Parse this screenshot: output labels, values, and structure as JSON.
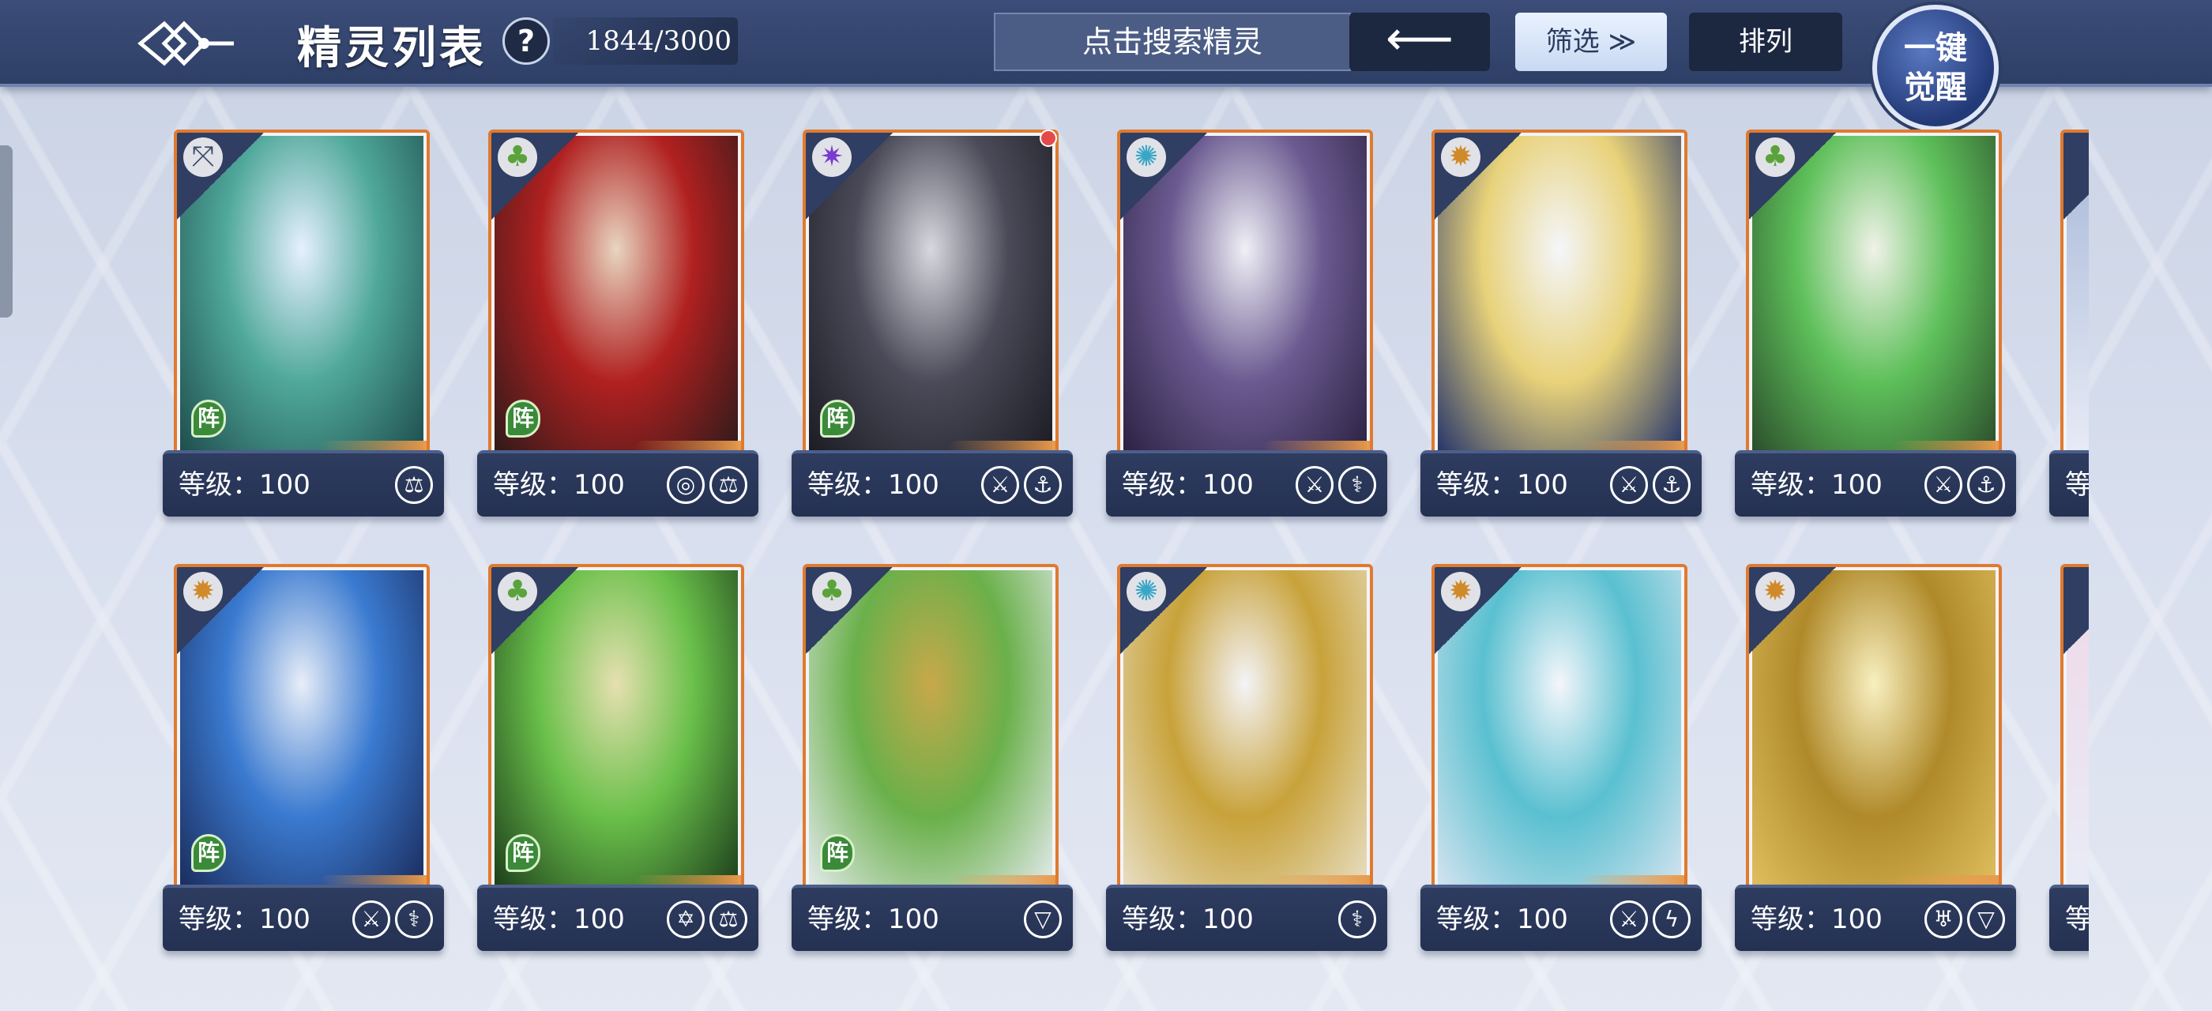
{
  "header": {
    "title": "精灵列表",
    "help_label": "?",
    "count": "1844/3000",
    "search_placeholder": "点击搜索精灵",
    "back_label": "⟵",
    "filter_label": "筛选 ≫",
    "sort_label": "排列",
    "awaken_line1": "一键",
    "awaken_line2": "觉醒"
  },
  "colors": {
    "topbar": "#33456e",
    "card_border": "#e07a2e",
    "card_bar": "#2a3758"
  },
  "cards": [
    {
      "element": "pixel-icon",
      "element_glyph": "⤧",
      "element_color": "#3a4a6a",
      "level": "等级：100",
      "formation": "阵",
      "traits": [
        "⚖"
      ],
      "art": [
        "#1d4a4a",
        "#4fa89a",
        "#e6f0ff"
      ]
    },
    {
      "element": "leaf-icon",
      "element_glyph": "♣",
      "element_color": "#5aa33a",
      "level": "等级：100",
      "formation": "阵",
      "traits": [
        "◎",
        "⚖"
      ],
      "art": [
        "#2a1a1a",
        "#b02020",
        "#e8d5c0"
      ]
    },
    {
      "element": "shadow-icon",
      "element_glyph": "✷",
      "element_color": "#7a3ad0",
      "level": "等级：100",
      "formation": "阵",
      "traits": [
        "⚔",
        "⚓"
      ],
      "art": [
        "#1a1a22",
        "#4a4a58",
        "#d8d8e0"
      ]
    },
    {
      "element": "star-ice-icon",
      "element_glyph": "✺",
      "element_color": "#3aa6c6",
      "level": "等级：100",
      "formation": "",
      "traits": [
        "⚔",
        "⚕"
      ],
      "art": [
        "#2a2040",
        "#6a5a90",
        "#f0f0f6"
      ]
    },
    {
      "element": "sun-icon",
      "element_glyph": "✹",
      "element_color": "#d08a2a",
      "level": "等级：100",
      "formation": "",
      "traits": [
        "⚔",
        "⚓"
      ],
      "art": [
        "#1e2f6a",
        "#e8d27a",
        "#f4f6fb"
      ]
    },
    {
      "element": "leaf-icon",
      "element_glyph": "♣",
      "element_color": "#5aa33a",
      "level": "等级：100",
      "formation": "",
      "traits": [
        "⚔",
        "⚓"
      ],
      "art": [
        "#2a4a2a",
        "#5ec05a",
        "#f0f2e8"
      ]
    },
    {
      "element": "sun-icon",
      "element_glyph": "✹",
      "element_color": "#d08a2a",
      "level": "等级：100",
      "formation": "阵",
      "traits": [
        "⚔",
        "⚕"
      ],
      "art": [
        "#1a2a5a",
        "#3a7ad0",
        "#e8eef8"
      ]
    },
    {
      "element": "leaf-icon",
      "element_glyph": "♣",
      "element_color": "#5aa33a",
      "level": "等级：100",
      "formation": "阵",
      "traits": [
        "✡",
        "⚖"
      ],
      "art": [
        "#1a3a1a",
        "#6ac04a",
        "#e6e0b0"
      ]
    },
    {
      "element": "leaf-icon",
      "element_glyph": "♣",
      "element_color": "#5aa33a",
      "level": "等级：100",
      "formation": "阵",
      "traits": [
        "▽"
      ],
      "art": [
        "#e8ecf2",
        "#6ab04a",
        "#c8a84a"
      ]
    },
    {
      "element": "star-ice-icon",
      "element_glyph": "✺",
      "element_color": "#3aa6c6",
      "level": "等级：100",
      "formation": "",
      "traits": [
        "⚕"
      ],
      "art": [
        "#e8e0c8",
        "#c8a23a",
        "#f4f4f8"
      ]
    },
    {
      "element": "sun-icon",
      "element_glyph": "✹",
      "element_color": "#d08a2a",
      "level": "等级：100",
      "formation": "",
      "traits": [
        "⚔",
        "ϟ"
      ],
      "art": [
        "#d8e4f0",
        "#5ac0d0",
        "#f4f6fb"
      ]
    },
    {
      "element": "sun-icon",
      "element_glyph": "✹",
      "element_color": "#d08a2a",
      "level": "等级：100",
      "formation": "",
      "traits": [
        "♅",
        "▽"
      ],
      "art": [
        "#e0c060",
        "#b08a2a",
        "#f8f0c0"
      ]
    }
  ],
  "partial_level": "等"
}
